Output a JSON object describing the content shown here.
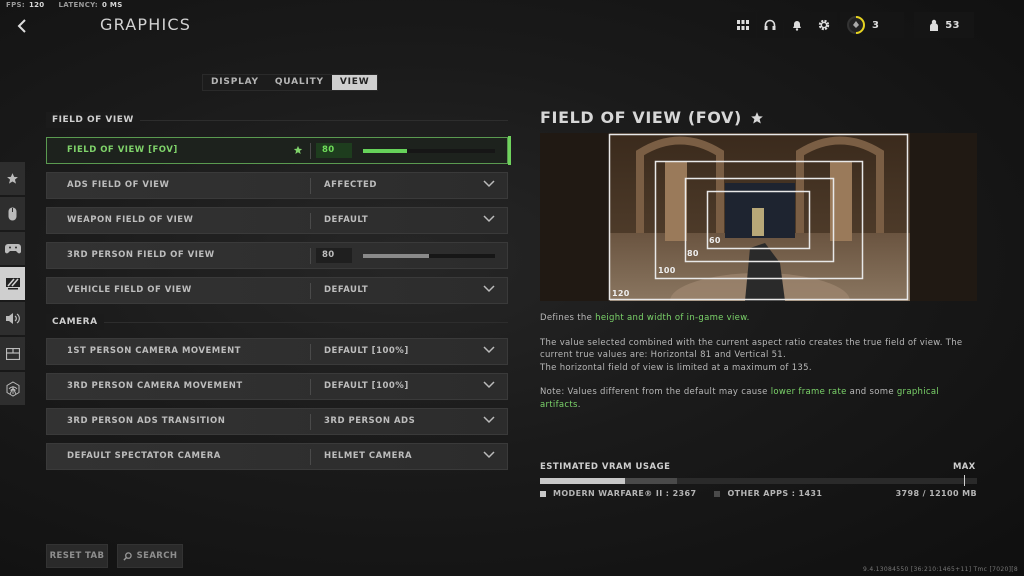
{
  "status": {
    "fps_label": "FPS:",
    "fps_value": "120",
    "latency_label": "LATENCY:",
    "latency_value": "0 MS"
  },
  "header": {
    "title": "GRAPHICS",
    "back_icon": "chevron-left-icon",
    "icons": [
      "grid-menu-icon",
      "headset-icon",
      "bell-icon",
      "gear-icon"
    ],
    "rank_value": "3",
    "players_value": "53"
  },
  "tabs": [
    {
      "label": "DISPLAY",
      "active": false
    },
    {
      "label": "QUALITY",
      "active": false
    },
    {
      "label": "VIEW",
      "active": true
    }
  ],
  "sidebar": {
    "items": [
      {
        "icon": "star-icon",
        "active": false
      },
      {
        "icon": "mouse-icon",
        "active": false
      },
      {
        "icon": "controller-icon",
        "active": false
      },
      {
        "icon": "monitor-icon",
        "active": true
      },
      {
        "icon": "speaker-icon",
        "active": false
      },
      {
        "icon": "interface-icon",
        "active": false
      },
      {
        "icon": "network-icon",
        "active": false
      }
    ]
  },
  "sections": {
    "fov": {
      "title": "FIELD OF VIEW",
      "rows": [
        {
          "label": "FIELD OF VIEW [FOV]",
          "type": "slider",
          "value": "80",
          "slider_fraction": 0.33,
          "favorite": true,
          "selected": true
        },
        {
          "label": "ADS FIELD OF VIEW",
          "type": "dropdown",
          "value": "AFFECTED"
        },
        {
          "label": "WEAPON FIELD OF VIEW",
          "type": "dropdown",
          "value": "DEFAULT"
        },
        {
          "label": "3RD PERSON FIELD OF VIEW",
          "type": "slider",
          "value": "80",
          "slider_fraction": 0.5
        },
        {
          "label": "VEHICLE FIELD OF VIEW",
          "type": "dropdown",
          "value": "DEFAULT"
        }
      ]
    },
    "camera": {
      "title": "CAMERA",
      "rows": [
        {
          "label": "1ST PERSON CAMERA MOVEMENT",
          "type": "dropdown",
          "value": "DEFAULT [100%]"
        },
        {
          "label": "3RD PERSON CAMERA MOVEMENT",
          "type": "dropdown",
          "value": "DEFAULT [100%]"
        },
        {
          "label": "3RD PERSON ADS TRANSITION",
          "type": "dropdown",
          "value": "3RD PERSON ADS"
        },
        {
          "label": "DEFAULT SPECTATOR CAMERA",
          "type": "dropdown",
          "value": "HELMET CAMERA"
        }
      ]
    }
  },
  "detail": {
    "title": "FIELD OF VIEW (FOV)",
    "preview_labels": [
      "120",
      "100",
      "80",
      "60"
    ],
    "desc1_pre": "Defines the ",
    "desc1_hl": "height and width of in-game view.",
    "desc2": "The value selected combined with the current aspect ratio creates the true field of view. The current true values are: Horizontal 81 and Vertical 51.",
    "desc3": "The horizontal field of view is limited at a maximum of 135.",
    "note_pre": "Note: Values different from the default may cause ",
    "note_hl1": "lower frame rate",
    "note_mid": " and some ",
    "note_hl2": "graphical artifacts",
    "note_end": "."
  },
  "vram": {
    "title": "ESTIMATED VRAM USAGE",
    "max_label": "MAX",
    "mw_label": "MODERN WARFARE® II : 2367",
    "other_label": "OTHER APPS : 1431",
    "total_label": "3798 / 12100 MB",
    "mw_mb": 2367,
    "other_mb": 1431,
    "total_mb": 12100,
    "max_fraction": 0.97,
    "colors": {
      "mw": "#c8c8c8",
      "other": "#4a4a4a"
    }
  },
  "footer": {
    "reset_label": "RESET TAB",
    "search_label": "SEARCH",
    "build": "9.4.13084550 [36:210:1465+11] Tmc [7020][8"
  },
  "accent_color": "#6fd35d"
}
